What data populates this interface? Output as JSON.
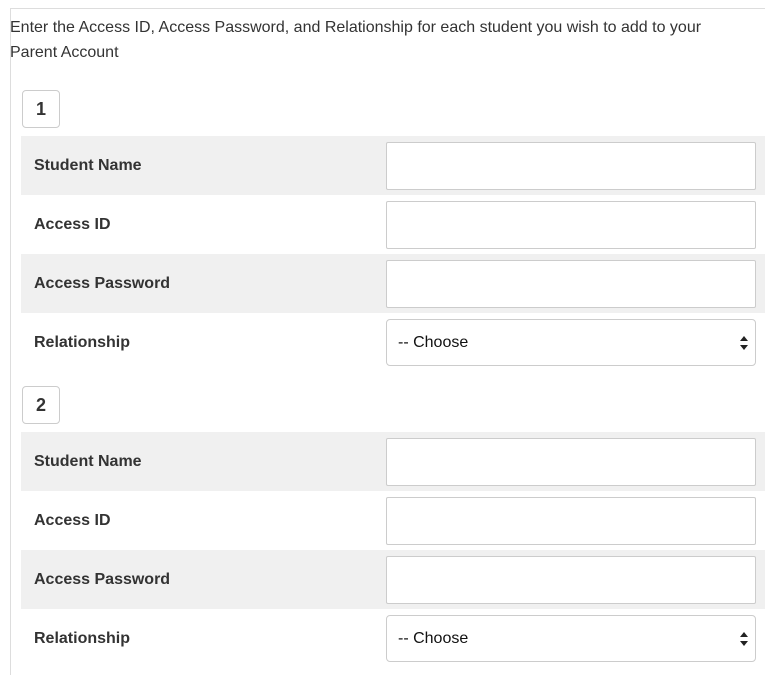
{
  "intro": "Enter the Access ID, Access Password, and Relationship for each student you wish to add to your Parent Account",
  "students": [
    {
      "number": "1",
      "student_name_label": "Student Name",
      "student_name_value": "",
      "access_id_label": "Access ID",
      "access_id_value": "",
      "access_password_label": "Access Password",
      "access_password_value": "",
      "relationship_label": "Relationship",
      "relationship_selected": "-- Choose"
    },
    {
      "number": "2",
      "student_name_label": "Student Name",
      "student_name_value": "",
      "access_id_label": "Access ID",
      "access_id_value": "",
      "access_password_label": "Access Password",
      "access_password_value": "",
      "relationship_label": "Relationship",
      "relationship_selected": "-- Choose"
    }
  ],
  "icons": {
    "select_arrows": "up-down-caret-icon"
  },
  "colors": {
    "row_shade": "#f0f0f0",
    "border": "#cccccc",
    "text": "#333333"
  }
}
